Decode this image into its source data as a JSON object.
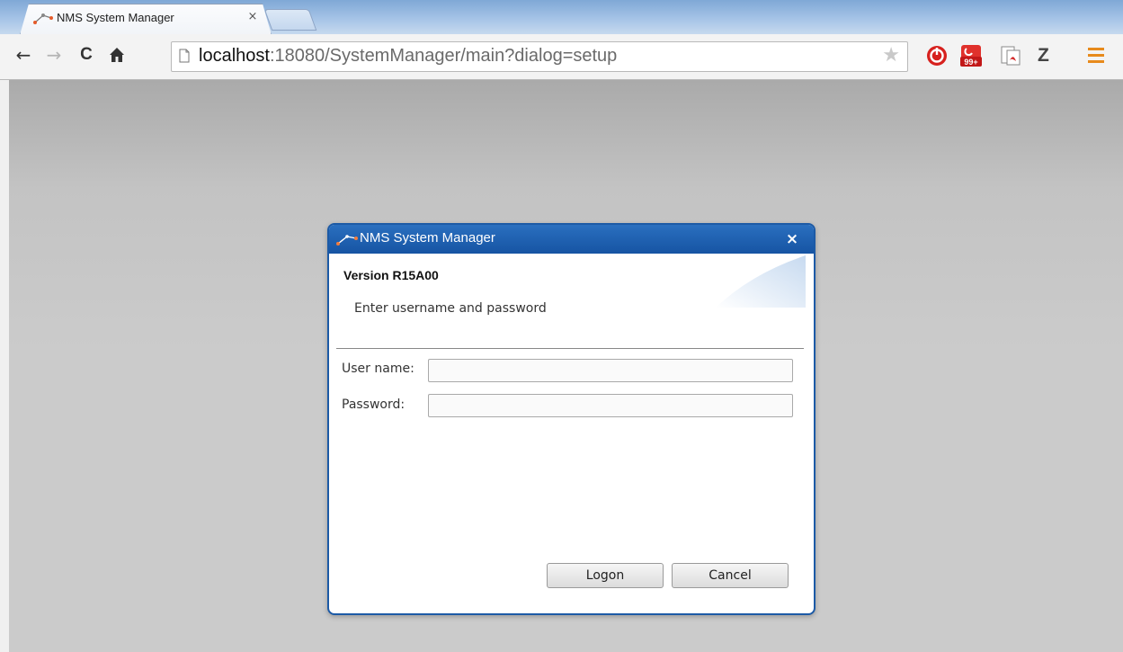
{
  "browser": {
    "tab_title": "NMS System Manager",
    "tab_close": "×",
    "url_host": "localhost",
    "url_rest": ":18080/SystemManager/main?dialog=setup",
    "bookmark_star": "★",
    "extension_z": "Z"
  },
  "nav": {
    "back": "←",
    "forward": "→",
    "reload": "C",
    "home": "🏠"
  },
  "icons": {
    "extension_1": "red-stop-icon",
    "extension_2": "badge-99-icon",
    "extension_3": "pdf-icon",
    "menu": "hamburger-menu-icon"
  },
  "dialog": {
    "title": "NMS System Manager",
    "close": "×",
    "version": "Version R15A00",
    "instruction": "Enter username and password",
    "username_label": "User name:",
    "username_value": "",
    "password_label": "Password:",
    "password_value": "",
    "logon_label": "Logon",
    "cancel_label": "Cancel"
  },
  "badge": "99+",
  "colors": {
    "dialog_accent": "#1c5aa6",
    "menu_orange": "#e78a1c"
  }
}
